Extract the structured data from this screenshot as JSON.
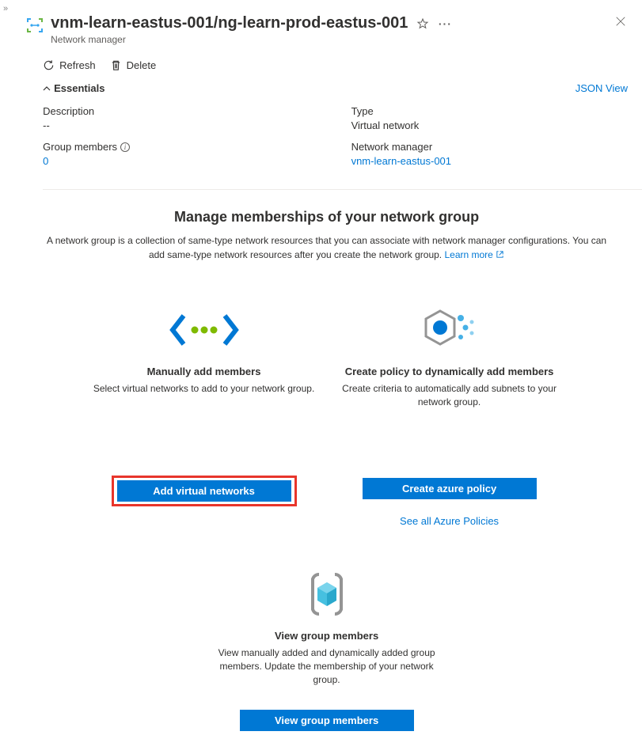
{
  "header": {
    "title": "vnm-learn-eastus-001/ng-learn-prod-eastus-001",
    "subtitle": "Network manager"
  },
  "toolbar": {
    "refresh": "Refresh",
    "delete": "Delete"
  },
  "essentials": {
    "label": "Essentials",
    "json_view": "JSON View",
    "left": {
      "description_label": "Description",
      "description_value": "--",
      "members_label": "Group members",
      "members_value": "0"
    },
    "right": {
      "type_label": "Type",
      "type_value": "Virtual network",
      "manager_label": "Network manager",
      "manager_value": "vnm-learn-eastus-001"
    }
  },
  "hero": {
    "title": "Manage memberships of your network group",
    "desc_a": "A network group is a collection of same-type network resources that you can associate with network manager configurations. You can add same-type network resources after you create the network group. ",
    "learn_more": "Learn more"
  },
  "cards": {
    "manual": {
      "title": "Manually add members",
      "desc": "Select virtual networks to add to your network group.",
      "button": "Add virtual networks"
    },
    "policy": {
      "title": "Create policy to dynamically add members",
      "desc": "Create criteria to automatically add subnets to your network group.",
      "button": "Create azure policy",
      "link": "See all Azure Policies"
    },
    "view": {
      "title": "View group members",
      "desc": "View manually added and dynamically added group members. Update the membership of your network group.",
      "button": "View group members"
    }
  }
}
